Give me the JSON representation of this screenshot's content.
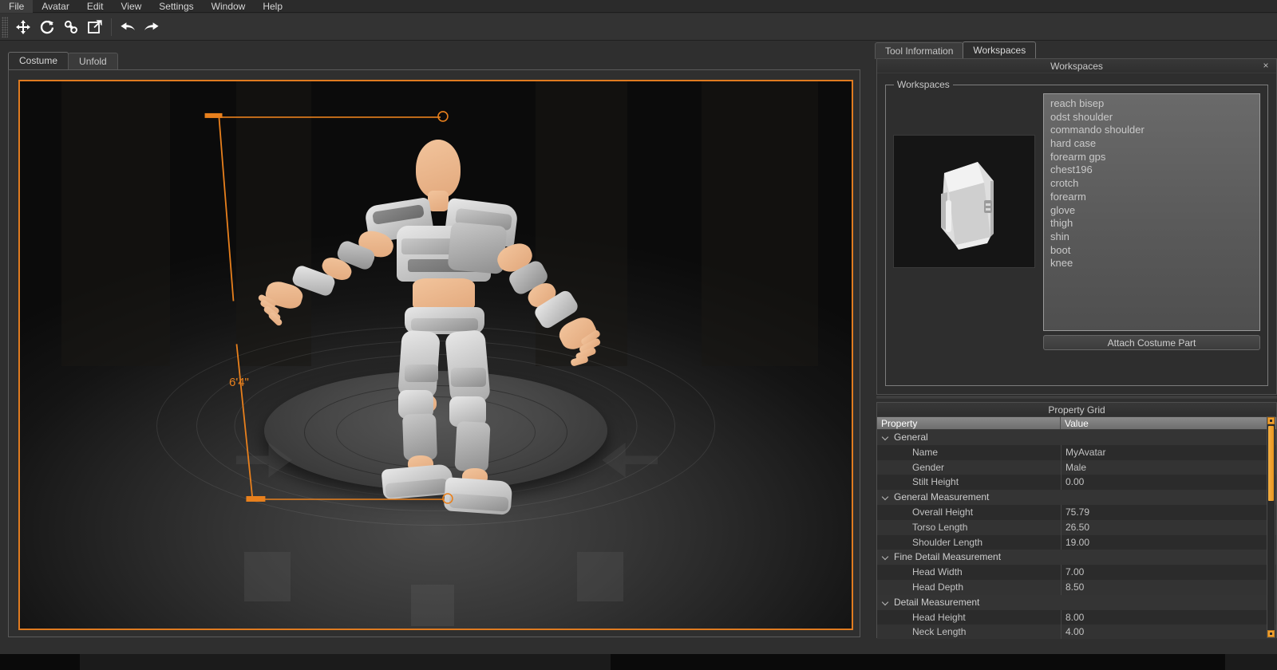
{
  "menubar": {
    "items": [
      {
        "label": "File"
      },
      {
        "label": "Avatar"
      },
      {
        "label": "Edit"
      },
      {
        "label": "View"
      },
      {
        "label": "Settings"
      },
      {
        "label": "Window"
      },
      {
        "label": "Help"
      }
    ]
  },
  "toolbar": {
    "buttons": [
      {
        "icon": "move-icon",
        "name": "move-tool"
      },
      {
        "icon": "rotate-icon",
        "name": "rotate-tool"
      },
      {
        "icon": "link-icon",
        "name": "link-tool"
      },
      {
        "icon": "scale-expand-icon",
        "name": "scale-tool"
      },
      {
        "icon": "undo-icon",
        "name": "undo-button"
      },
      {
        "icon": "redo-icon",
        "name": "redo-button"
      }
    ]
  },
  "left_tabs": {
    "items": [
      {
        "label": "Costume",
        "active": true
      },
      {
        "label": "Unfold",
        "active": false
      }
    ]
  },
  "viewport": {
    "measurement_label": "6'4\"",
    "accent_color": "#e07b20",
    "selection_border_color": "#e07b20"
  },
  "right_tabs": {
    "items": [
      {
        "label": "Tool Information",
        "active": false
      },
      {
        "label": "Workspaces",
        "active": true
      }
    ]
  },
  "workspaces_panel": {
    "title": "Workspaces",
    "close_label": "×",
    "group_legend": "Workspaces",
    "items": [
      {
        "label": "reach bisep"
      },
      {
        "label": "odst shoulder"
      },
      {
        "label": "commando shoulder"
      },
      {
        "label": "hard case"
      },
      {
        "label": "forearm gps"
      },
      {
        "label": "chest196"
      },
      {
        "label": "crotch"
      },
      {
        "label": "forearm"
      },
      {
        "label": "glove"
      },
      {
        "label": "thigh"
      },
      {
        "label": "shin"
      },
      {
        "label": "boot"
      },
      {
        "label": "knee"
      }
    ],
    "attach_button_label": "Attach Costume Part"
  },
  "property_grid": {
    "title": "Property Grid",
    "columns": [
      "Property",
      "Value"
    ],
    "rows": [
      {
        "type": "category",
        "name": "General",
        "value": ""
      },
      {
        "type": "item",
        "name": "Name",
        "value": "MyAvatar"
      },
      {
        "type": "item",
        "name": "Gender",
        "value": "Male"
      },
      {
        "type": "item",
        "name": "Stilt Height",
        "value": "0.00"
      },
      {
        "type": "category",
        "name": "General Measurement",
        "value": ""
      },
      {
        "type": "item",
        "name": "Overall Height",
        "value": "75.79"
      },
      {
        "type": "item",
        "name": "Torso Length",
        "value": "26.50"
      },
      {
        "type": "item",
        "name": "Shoulder Length",
        "value": "19.00"
      },
      {
        "type": "category",
        "name": "Fine Detail Measurement",
        "value": ""
      },
      {
        "type": "item",
        "name": "Head Width",
        "value": "7.00"
      },
      {
        "type": "item",
        "name": "Head Depth",
        "value": "8.50"
      },
      {
        "type": "category",
        "name": "Detail Measurement",
        "value": ""
      },
      {
        "type": "item",
        "name": "Head Height",
        "value": "8.00"
      },
      {
        "type": "item",
        "name": "Neck Length",
        "value": "4.00"
      }
    ],
    "scrollbar_color": "#f0a030"
  }
}
